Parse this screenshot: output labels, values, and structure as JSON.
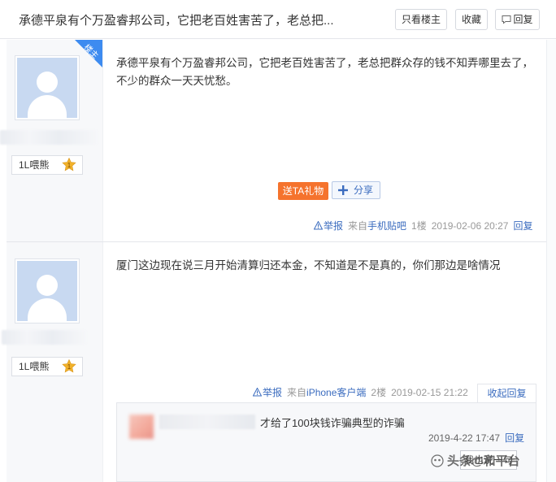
{
  "header": {
    "title": "承德平泉有个万盈睿邦公司，它把老百姓害苦了，老总把...",
    "only_louzhu": "只看楼主",
    "favorite": "收藏",
    "reply": "回复"
  },
  "posts": [
    {
      "badge": "楼主",
      "level": "1L喂熊",
      "content": "承德平泉有个万盈睿邦公司，它把老百姓害苦了，老总把群众存的钱不知弄哪里去了，不少的群众一天天忧愁。",
      "gift_label": "送TA礼物",
      "share_label": "分享",
      "report": "举报",
      "source_prefix": "来自",
      "source_client": "手机贴吧",
      "floor": "1楼",
      "time": "2019-02-06 20:27",
      "reply": "回复"
    },
    {
      "level": "1L喂熊",
      "content": "厦门这边现在说三月开始清算归还本金，不知道是不是真的，你们那边是啥情况",
      "report": "举报",
      "source_prefix": "来自",
      "source_client": "iPhone客户端",
      "floor": "2楼",
      "time": "2019-02-15 21:22",
      "collapse": "收起回复",
      "subreply": {
        "text": "才给了100块钱诈骗典型的诈骗",
        "time": "2019-4-22 17:47",
        "reply": "回复",
        "button": "我也说一句"
      }
    }
  ],
  "watermark": "头条@和平台",
  "colors": {
    "accent_blue": "#3b6cbf",
    "gift_orange": "#f5732d",
    "badge_blue": "#3d8bf0",
    "avatar_bg": "#c8d9f1"
  }
}
